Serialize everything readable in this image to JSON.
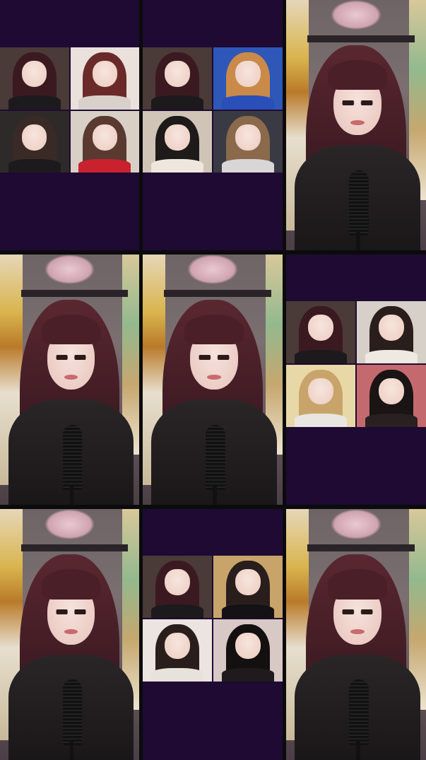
{
  "colors": {
    "tile_background": "#1e0a32",
    "grid_gap": "#0b0b0d"
  },
  "tiles": [
    {
      "id": 1,
      "kind": "multi-guest",
      "guests": [
        {
          "hair": "#3a1a20",
          "bg": "#4a3a38",
          "body": "#1c1a1c"
        },
        {
          "hair": "#6b2a2a",
          "bg": "#eae0dc",
          "body": "#d9d0cc"
        },
        {
          "hair": "#3a2a25",
          "bg": "#2f2a2a",
          "body": "#1c1a1c"
        },
        {
          "hair": "#5a3a30",
          "bg": "#d8d0c6",
          "body": "#c8222e"
        }
      ]
    },
    {
      "id": 2,
      "kind": "multi-guest",
      "guests": [
        {
          "hair": "#3a1a20",
          "bg": "#4a3a38",
          "body": "#1c1a1c"
        },
        {
          "hair": "#c98a4a",
          "bg": "#2e57b7",
          "body": "#2a4fb8"
        },
        {
          "hair": "#1e1a1a",
          "bg": "#cfc4b6",
          "body": "#efe7dd"
        },
        {
          "hair": "#8a6a4a",
          "bg": "#3a3a44",
          "body": "#d9d6d8"
        }
      ]
    },
    {
      "id": 3,
      "kind": "solo"
    },
    {
      "id": 4,
      "kind": "solo"
    },
    {
      "id": 5,
      "kind": "solo"
    },
    {
      "id": 6,
      "kind": "multi-guest",
      "guests": [
        {
          "hair": "#3a1a20",
          "bg": "#4a3a38",
          "body": "#1c1a1c"
        },
        {
          "hair": "#2a1e1c",
          "bg": "#d6d0c8",
          "body": "#efe9e2"
        },
        {
          "hair": "#c9a46a",
          "bg": "#e8d8a8",
          "body": "#e9e5e0"
        },
        {
          "hair": "#1a1414",
          "bg": "#c46a6e",
          "body": "#2a2020"
        }
      ]
    },
    {
      "id": 7,
      "kind": "solo"
    },
    {
      "id": 8,
      "kind": "multi-guest",
      "guests": [
        {
          "hair": "#3a1a20",
          "bg": "#4a3a38",
          "body": "#1c1a1c"
        },
        {
          "hair": "#2a1e1c",
          "bg": "#c9a46a",
          "body": "#141214"
        },
        {
          "hair": "#2a1e1c",
          "bg": "#ece4e0",
          "body": "#e8e2dc"
        },
        {
          "hair": "#141010",
          "bg": "#d8c8c6",
          "body": "#201a1c"
        }
      ]
    },
    {
      "id": 9,
      "kind": "solo"
    }
  ]
}
